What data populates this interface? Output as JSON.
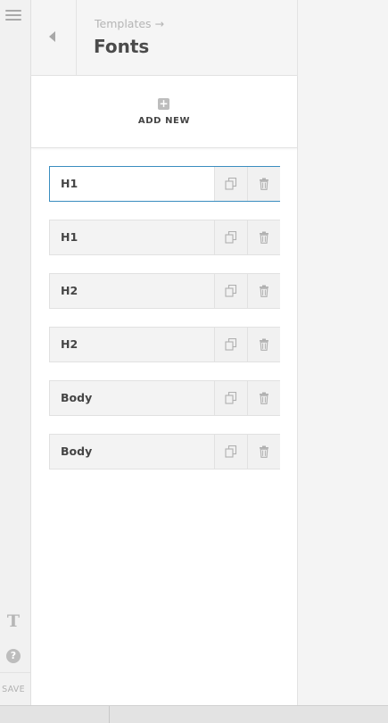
{
  "sidebar": {
    "save_label": "SAVE",
    "text_icon": "T",
    "help_icon": "?"
  },
  "header": {
    "breadcrumb": "Templates →",
    "title": "Fonts"
  },
  "add_new": {
    "label": "ADD NEW",
    "icon": "+"
  },
  "fonts": [
    {
      "label": "H1",
      "active": true
    },
    {
      "label": "H1",
      "active": false
    },
    {
      "label": "H2",
      "active": false
    },
    {
      "label": "H2",
      "active": false
    },
    {
      "label": "Body",
      "active": false
    },
    {
      "label": "Body",
      "active": false
    }
  ],
  "colors": {
    "active_border": "#3a8dbf",
    "icon_gray": "#b0b0b0"
  }
}
